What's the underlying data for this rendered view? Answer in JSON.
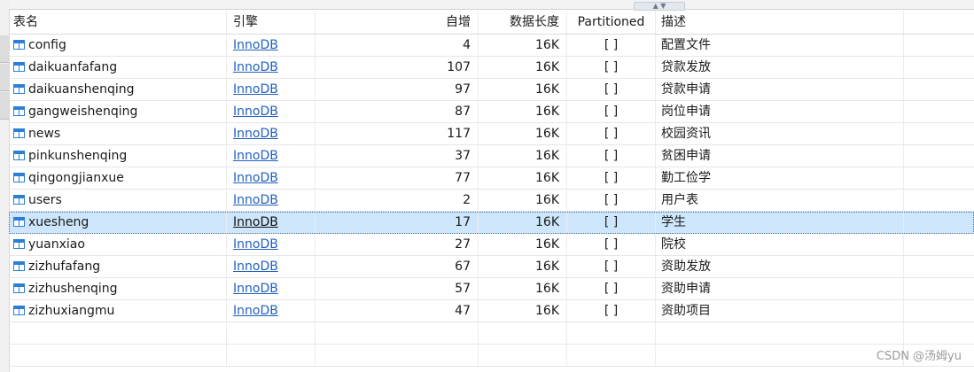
{
  "header": {
    "name": "表名",
    "engine": "引擎",
    "auto_increment": "自增",
    "data_length": "数据长度",
    "partitioned": "Partitioned",
    "description": "描述"
  },
  "icons": {
    "row": "table-icon"
  },
  "rows": [
    {
      "name": "config",
      "engine": "InnoDB",
      "auto": "4",
      "len": "16K",
      "part": "[ ]",
      "desc": "配置文件"
    },
    {
      "name": "daikuanfafang",
      "engine": "InnoDB",
      "auto": "107",
      "len": "16K",
      "part": "[ ]",
      "desc": "贷款发放"
    },
    {
      "name": "daikuanshenqing",
      "engine": "InnoDB",
      "auto": "97",
      "len": "16K",
      "part": "[ ]",
      "desc": "贷款申请"
    },
    {
      "name": "gangweishenqing",
      "engine": "InnoDB",
      "auto": "87",
      "len": "16K",
      "part": "[ ]",
      "desc": "岗位申请"
    },
    {
      "name": "news",
      "engine": "InnoDB",
      "auto": "117",
      "len": "16K",
      "part": "[ ]",
      "desc": "校园资讯"
    },
    {
      "name": "pinkunshenqing",
      "engine": "InnoDB",
      "auto": "37",
      "len": "16K",
      "part": "[ ]",
      "desc": "贫困申请"
    },
    {
      "name": "qingongjianxue",
      "engine": "InnoDB",
      "auto": "77",
      "len": "16K",
      "part": "[ ]",
      "desc": "勤工俭学"
    },
    {
      "name": "users",
      "engine": "InnoDB",
      "auto": "2",
      "len": "16K",
      "part": "[ ]",
      "desc": "用户表"
    },
    {
      "name": "xuesheng",
      "engine": "InnoDB",
      "auto": "17",
      "len": "16K",
      "part": "[ ]",
      "desc": "学生",
      "selected": true
    },
    {
      "name": "yuanxiao",
      "engine": "InnoDB",
      "auto": "27",
      "len": "16K",
      "part": "[ ]",
      "desc": "院校"
    },
    {
      "name": "zizhufafang",
      "engine": "InnoDB",
      "auto": "67",
      "len": "16K",
      "part": "[ ]",
      "desc": "资助发放"
    },
    {
      "name": "zizhushenqing",
      "engine": "InnoDB",
      "auto": "57",
      "len": "16K",
      "part": "[ ]",
      "desc": "资助申请"
    },
    {
      "name": "zizhuxiangmu",
      "engine": "InnoDB",
      "auto": "47",
      "len": "16K",
      "part": "[ ]",
      "desc": "资助项目"
    }
  ],
  "watermark": "CSDN @汤姆yu",
  "colors": {
    "selection": "#cde6fb",
    "link": "#1f5fbf",
    "icon": "#2c7fd6"
  }
}
